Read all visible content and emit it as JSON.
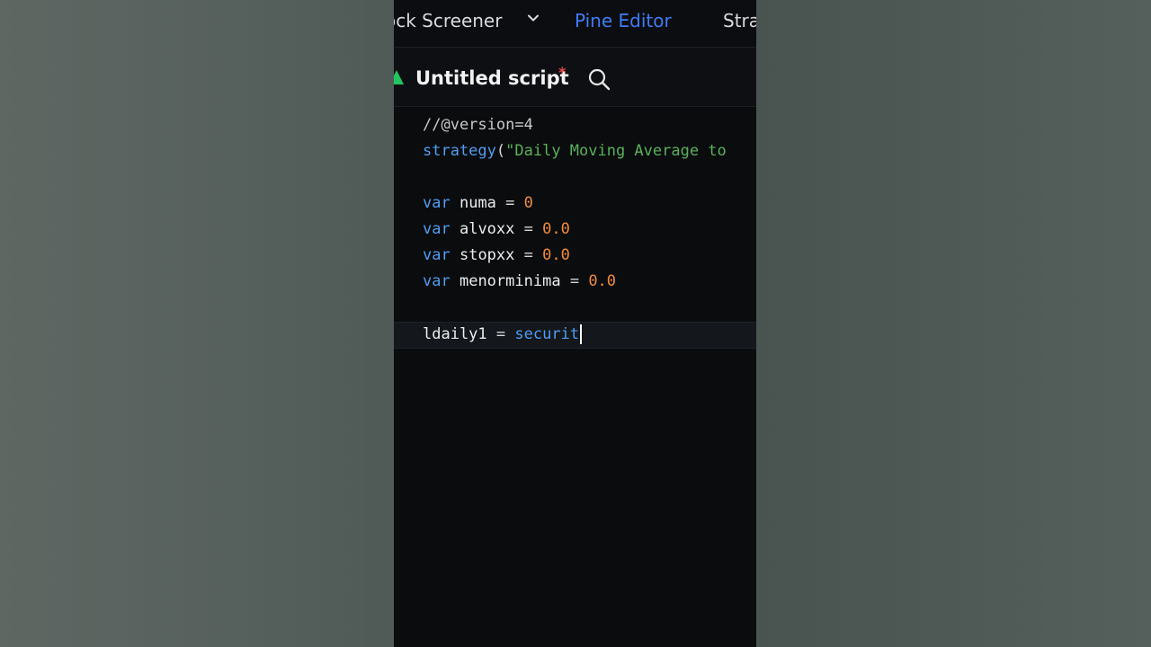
{
  "nav": {
    "items": [
      {
        "label": "ock Screener"
      },
      {
        "label": "Pine Editor"
      },
      {
        "label": "Stra"
      }
    ],
    "active": "Pine Editor",
    "accent_color": "#3d7cf5"
  },
  "editor": {
    "title": "Untitled script",
    "unsaved_marker": "*",
    "unsaved_color": "#e84a4a"
  },
  "icons": {
    "dropdown": "chevron-down-icon",
    "search": "search-icon",
    "logo": "app-logo-icon"
  },
  "code": {
    "line1": {
      "comment": "//@version=4"
    },
    "line2": {
      "func": "strategy",
      "open": "(",
      "string": "\"Daily Moving Average to"
    },
    "line4": {
      "kw": "var",
      "name": "numa",
      "op": "=",
      "num": "0"
    },
    "line5": {
      "kw": "var",
      "name": "alvoxx",
      "op": "=",
      "num": "0.0"
    },
    "line6": {
      "kw": "var",
      "name": "stopxx",
      "op": "=",
      "num": "0.0"
    },
    "line7": {
      "kw": "var",
      "name": "menorminima",
      "op": "=",
      "num": "0.0"
    },
    "line9": {
      "name": "ldaily1",
      "op": "=",
      "func": "securit"
    }
  },
  "syntax_colors": {
    "function": "#4e9df0",
    "string": "#59b15b",
    "number": "#f28c3b",
    "keyword": "#4e9df0"
  }
}
